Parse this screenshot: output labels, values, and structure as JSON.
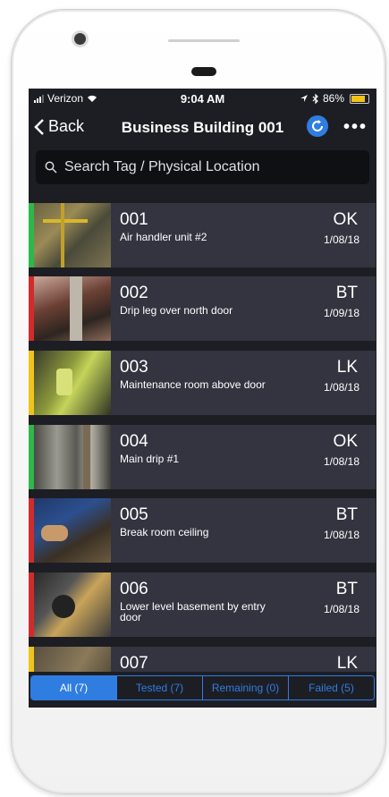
{
  "status_bar": {
    "carrier": "Verizon",
    "time": "9:04 AM",
    "battery": "86%"
  },
  "nav": {
    "back_label": "Back",
    "title": "Business Building 001"
  },
  "search": {
    "placeholder": "Search Tag / Physical Location"
  },
  "colors": {
    "ok": "#2db84a",
    "fail": "#d22b2b",
    "leak": "#f0c419",
    "accent": "#2f7de1"
  },
  "items": [
    {
      "tag": "001",
      "desc": "Air handler unit #2",
      "code": "OK",
      "date": "1/08/18",
      "color": "#2db84a"
    },
    {
      "tag": "002",
      "desc": "Drip leg over north door",
      "code": "BT",
      "date": "1/09/18",
      "color": "#d22b2b"
    },
    {
      "tag": "003",
      "desc": "Maintenance room above door",
      "code": "LK",
      "date": "1/08/18",
      "color": "#f0c419"
    },
    {
      "tag": "004",
      "desc": "Main drip #1",
      "code": "OK",
      "date": "1/08/18",
      "color": "#2db84a"
    },
    {
      "tag": "005",
      "desc": "Break room ceiling",
      "code": "BT",
      "date": "1/08/18",
      "color": "#d22b2b"
    },
    {
      "tag": "006",
      "desc": "Lower level basement by entry door",
      "code": "BT",
      "date": "1/08/18",
      "color": "#d22b2b"
    },
    {
      "tag": "007",
      "desc": "",
      "code": "LK",
      "date": "",
      "color": "#f0c419"
    }
  ],
  "tabs": [
    {
      "label": "All (7)"
    },
    {
      "label": "Tested (7)"
    },
    {
      "label": "Remaining (0)"
    },
    {
      "label": "Failed (5)"
    }
  ]
}
